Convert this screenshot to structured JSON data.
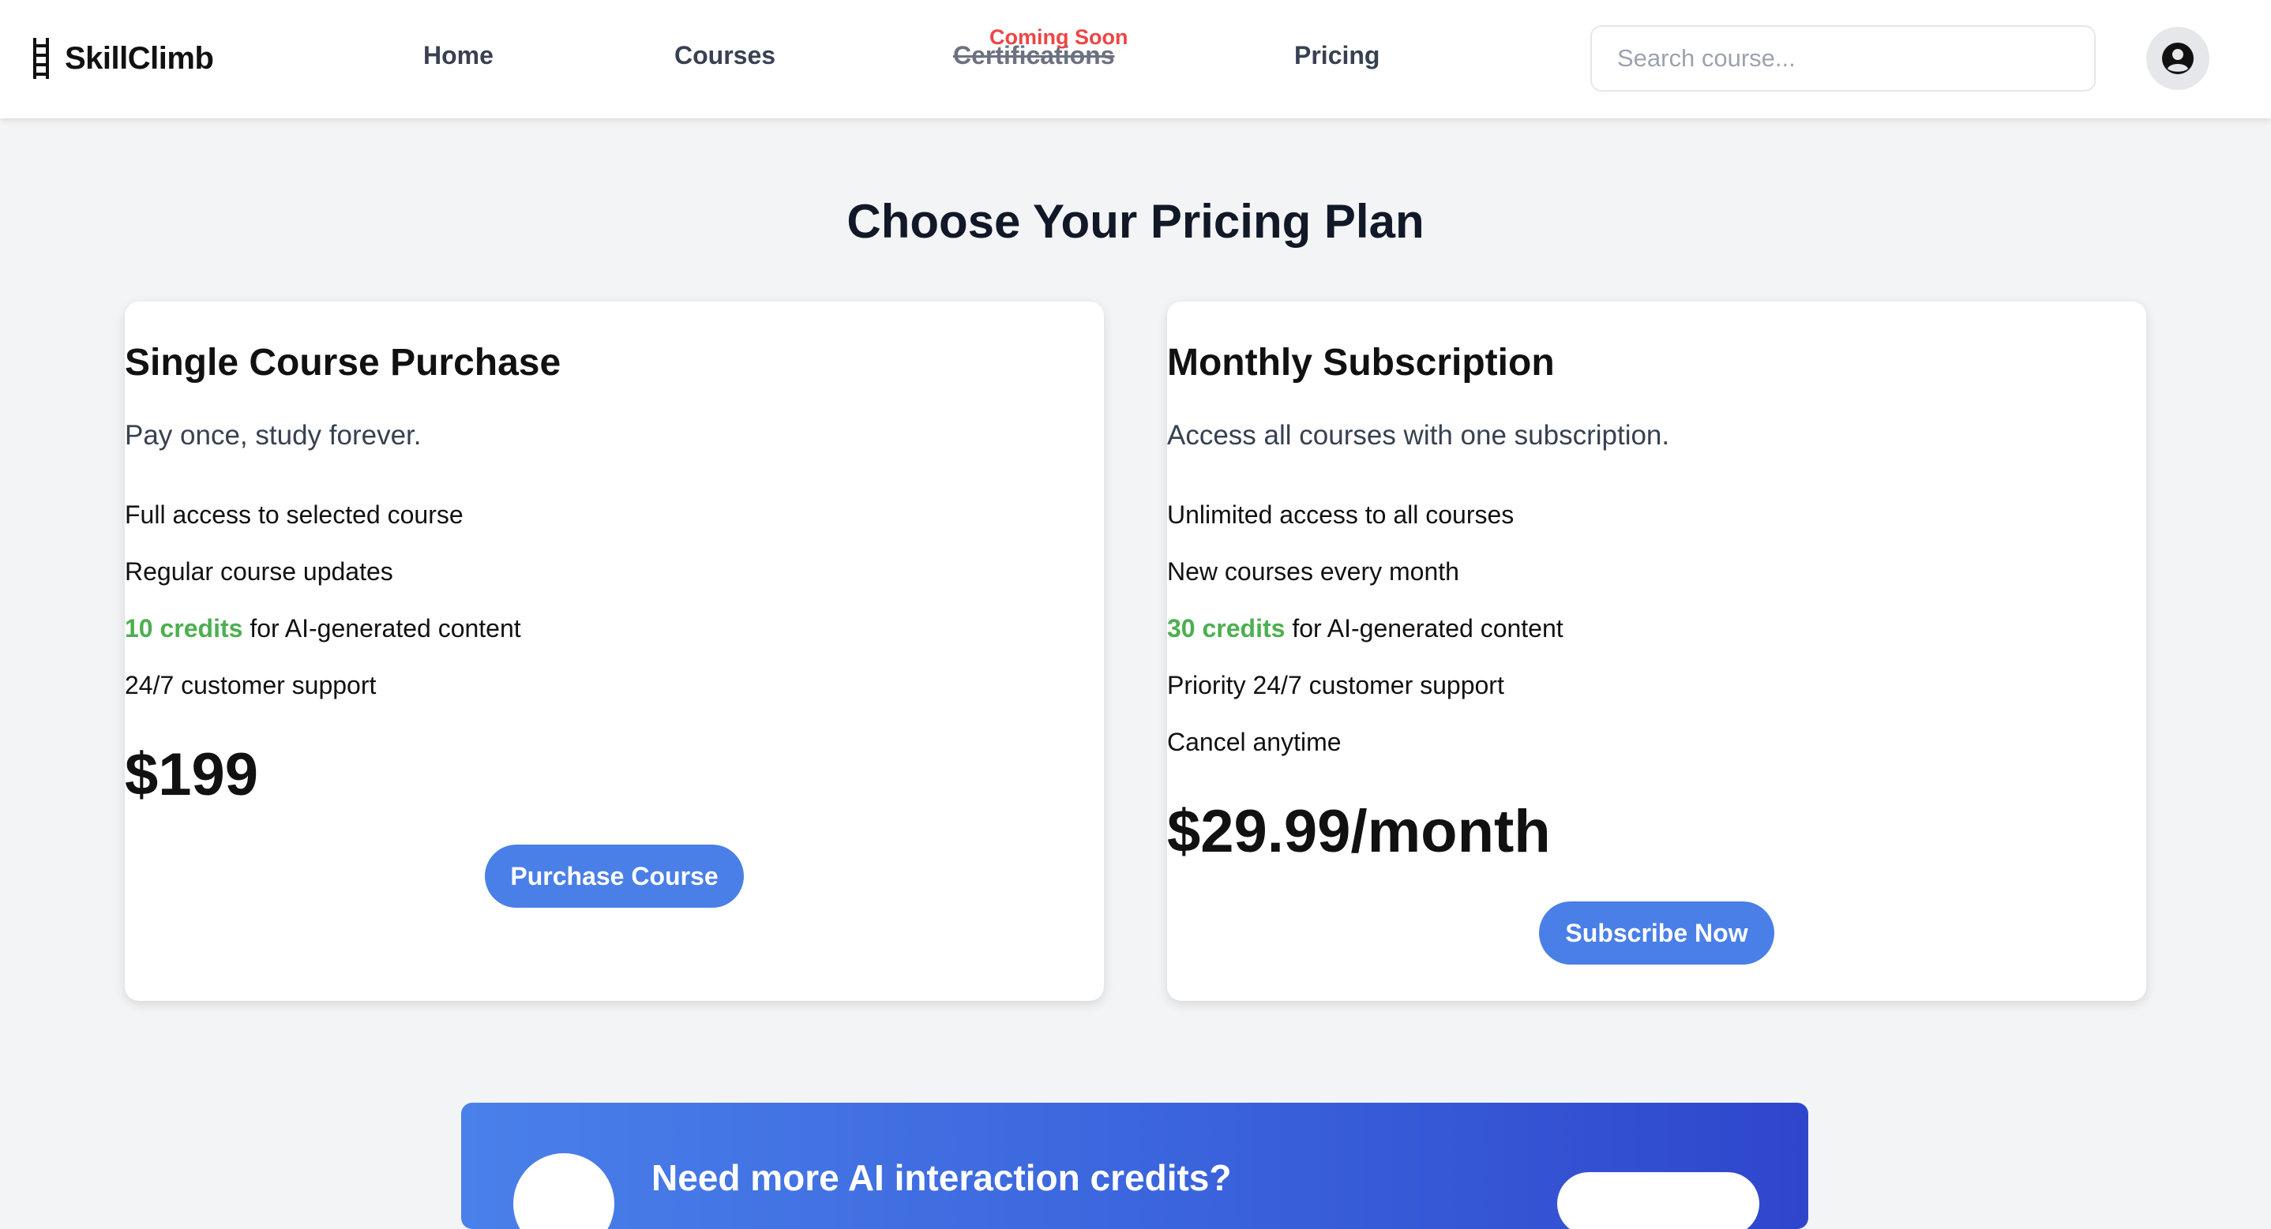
{
  "header": {
    "brand": "SkillClimb",
    "nav": {
      "home": "Home",
      "courses": "Courses",
      "certifications": "Certifications",
      "certifications_badge": "Coming Soon",
      "pricing": "Pricing"
    },
    "search": {
      "placeholder": "Search course..."
    },
    "avatar_icon": "user-circle-icon"
  },
  "main": {
    "title": "Choose Your Pricing Plan",
    "plans": [
      {
        "title": "Single Course Purchase",
        "subtitle": "Pay once, study forever.",
        "features": [
          "Full access to selected course",
          "Regular course updates",
          "for AI-generated content",
          "24/7 customer support"
        ],
        "credits": "10 credits",
        "price": "$199",
        "cta": "Purchase Course"
      },
      {
        "title": "Monthly Subscription",
        "subtitle": "Access all courses with one subscription.",
        "features": [
          "Unlimited access to all courses",
          "New courses every month",
          "for AI-generated content",
          "Priority 24/7 customer support",
          "Cancel anytime"
        ],
        "credits": "30 credits",
        "price": "$29.99/month",
        "cta": "Subscribe Now"
      }
    ]
  },
  "banner": {
    "title": "Need more AI interaction credits?"
  },
  "colors": {
    "accent": "#4a7fe8",
    "credits": "#4caf50",
    "coming_soon": "#ef4444",
    "background": "#f3f4f6"
  }
}
